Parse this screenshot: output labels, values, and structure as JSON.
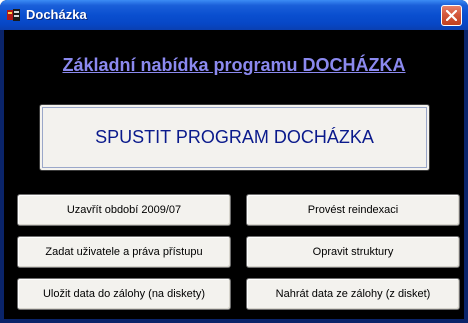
{
  "window": {
    "title": "Docházka",
    "icon": "app-icon",
    "close_icon": "close-icon"
  },
  "main": {
    "heading": "Základní nabídka programu DOCHÁZKA",
    "start_button": "SPUSTIT PROGRAM DOCHÁZKA",
    "buttons": [
      {
        "label": "Uzavřít období 2009/07"
      },
      {
        "label": "Provést reindexaci"
      },
      {
        "label": "Zadat uživatele a práva přístupu"
      },
      {
        "label": "Opravit struktury"
      },
      {
        "label": "Uložit data do zálohy (na diskety)"
      },
      {
        "label": "Nahrát data ze zálohy (z disket)"
      }
    ]
  },
  "colors": {
    "titlebar": "#0a4fd0",
    "client_background": "#000000",
    "heading": "#8b89ef",
    "start_button_text": "#0a1a8c",
    "close_button": "#d4583c"
  }
}
